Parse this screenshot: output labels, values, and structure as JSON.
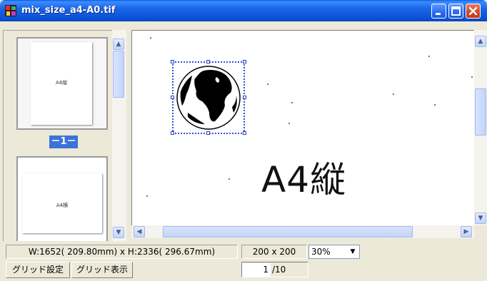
{
  "window": {
    "title": "mix_size_a4-A0.tif",
    "title_color": "#0a52d8",
    "close_color": "#d8482a"
  },
  "thumbnails": {
    "items": [
      {
        "label": "A4縦",
        "badge": "－1－",
        "selected": true
      },
      {
        "label": "A4横"
      }
    ]
  },
  "canvas": {
    "text": "A4縦",
    "selected_object": "globe-image"
  },
  "status": {
    "dimensions": "W:1652( 209.80mm) x H:2336( 296.67mm)",
    "resolution": "200 x 200",
    "zoom": "30%",
    "grid_settings_label": "グリッド設定",
    "grid_show_label": "グリッド表示",
    "page_current": "1",
    "page_total": "/10"
  }
}
